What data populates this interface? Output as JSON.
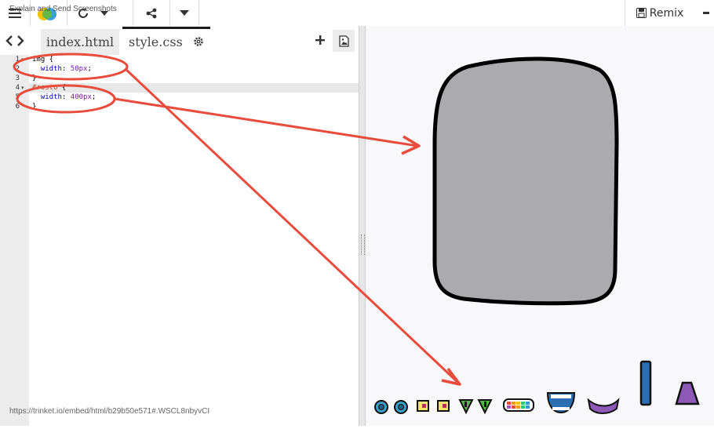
{
  "toolbar": {
    "extension_label": "Explain and Send Screenshots",
    "remix_label": "Remix"
  },
  "tabs": [
    {
      "label": "index.html"
    },
    {
      "label": "style.css"
    }
  ],
  "editor": {
    "line_numbers": [
      "1",
      "2",
      "3",
      "4",
      "5",
      "6"
    ]
  },
  "status": {
    "url": "https://trinket.io/embed/html/b29b50e571#.WSCL8nbyvCI"
  },
  "colors": {
    "annotation_red": "#e74c3c",
    "face_gray": "#abaaad",
    "active_tab_border": "#1a1a1a"
  },
  "icons": [
    "menu-icon",
    "logo-icon",
    "refresh-icon",
    "caret-down-icon",
    "share-icon",
    "save-icon",
    "gear-icon",
    "plus-icon",
    "image-icon",
    "chevron-left-icon",
    "chevron-right-icon"
  ]
}
